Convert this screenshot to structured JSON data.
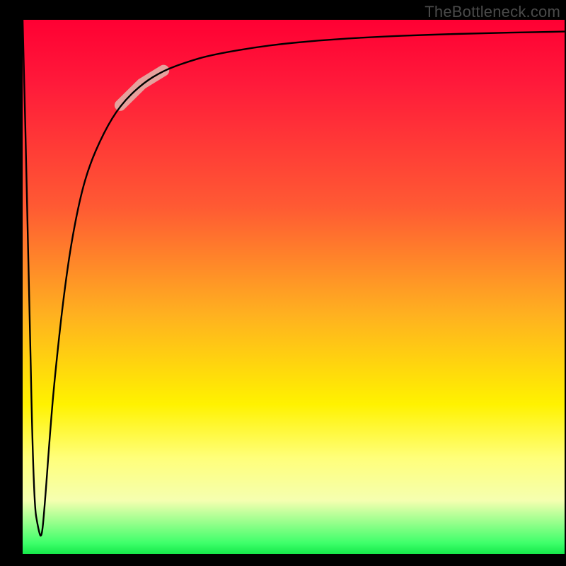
{
  "watermark": "TheBottleneck.com",
  "chart_data": {
    "type": "line",
    "title": "",
    "xlabel": "",
    "ylabel": "",
    "xlim": [
      0,
      100
    ],
    "ylim": [
      0,
      100
    ],
    "series": [
      {
        "name": "curve",
        "x": [
          0,
          1,
          2,
          3,
          3.5,
          4,
          5,
          6,
          8,
          10,
          12,
          15,
          18,
          22,
          26,
          30,
          35,
          45,
          55,
          65,
          75,
          85,
          95,
          100
        ],
        "y": [
          100,
          60,
          10,
          4,
          3,
          8,
          22,
          34,
          52,
          64,
          72,
          79,
          84,
          88,
          90.5,
          92,
          93.5,
          95.2,
          96.2,
          96.8,
          97.2,
          97.5,
          97.7,
          97.8
        ]
      }
    ],
    "highlight_segment": {
      "series": "curve",
      "x_range": [
        18,
        28
      ],
      "note": "pink rounded highlight on ascending part"
    },
    "background_gradient": {
      "direction": "top-to-bottom",
      "stops": [
        {
          "pos": 0.0,
          "color": "#ff0033"
        },
        {
          "pos": 0.35,
          "color": "#ff5a33"
        },
        {
          "pos": 0.72,
          "color": "#fff200"
        },
        {
          "pos": 0.9,
          "color": "#f5ffb0"
        },
        {
          "pos": 1.0,
          "color": "#15e84a"
        }
      ]
    }
  }
}
